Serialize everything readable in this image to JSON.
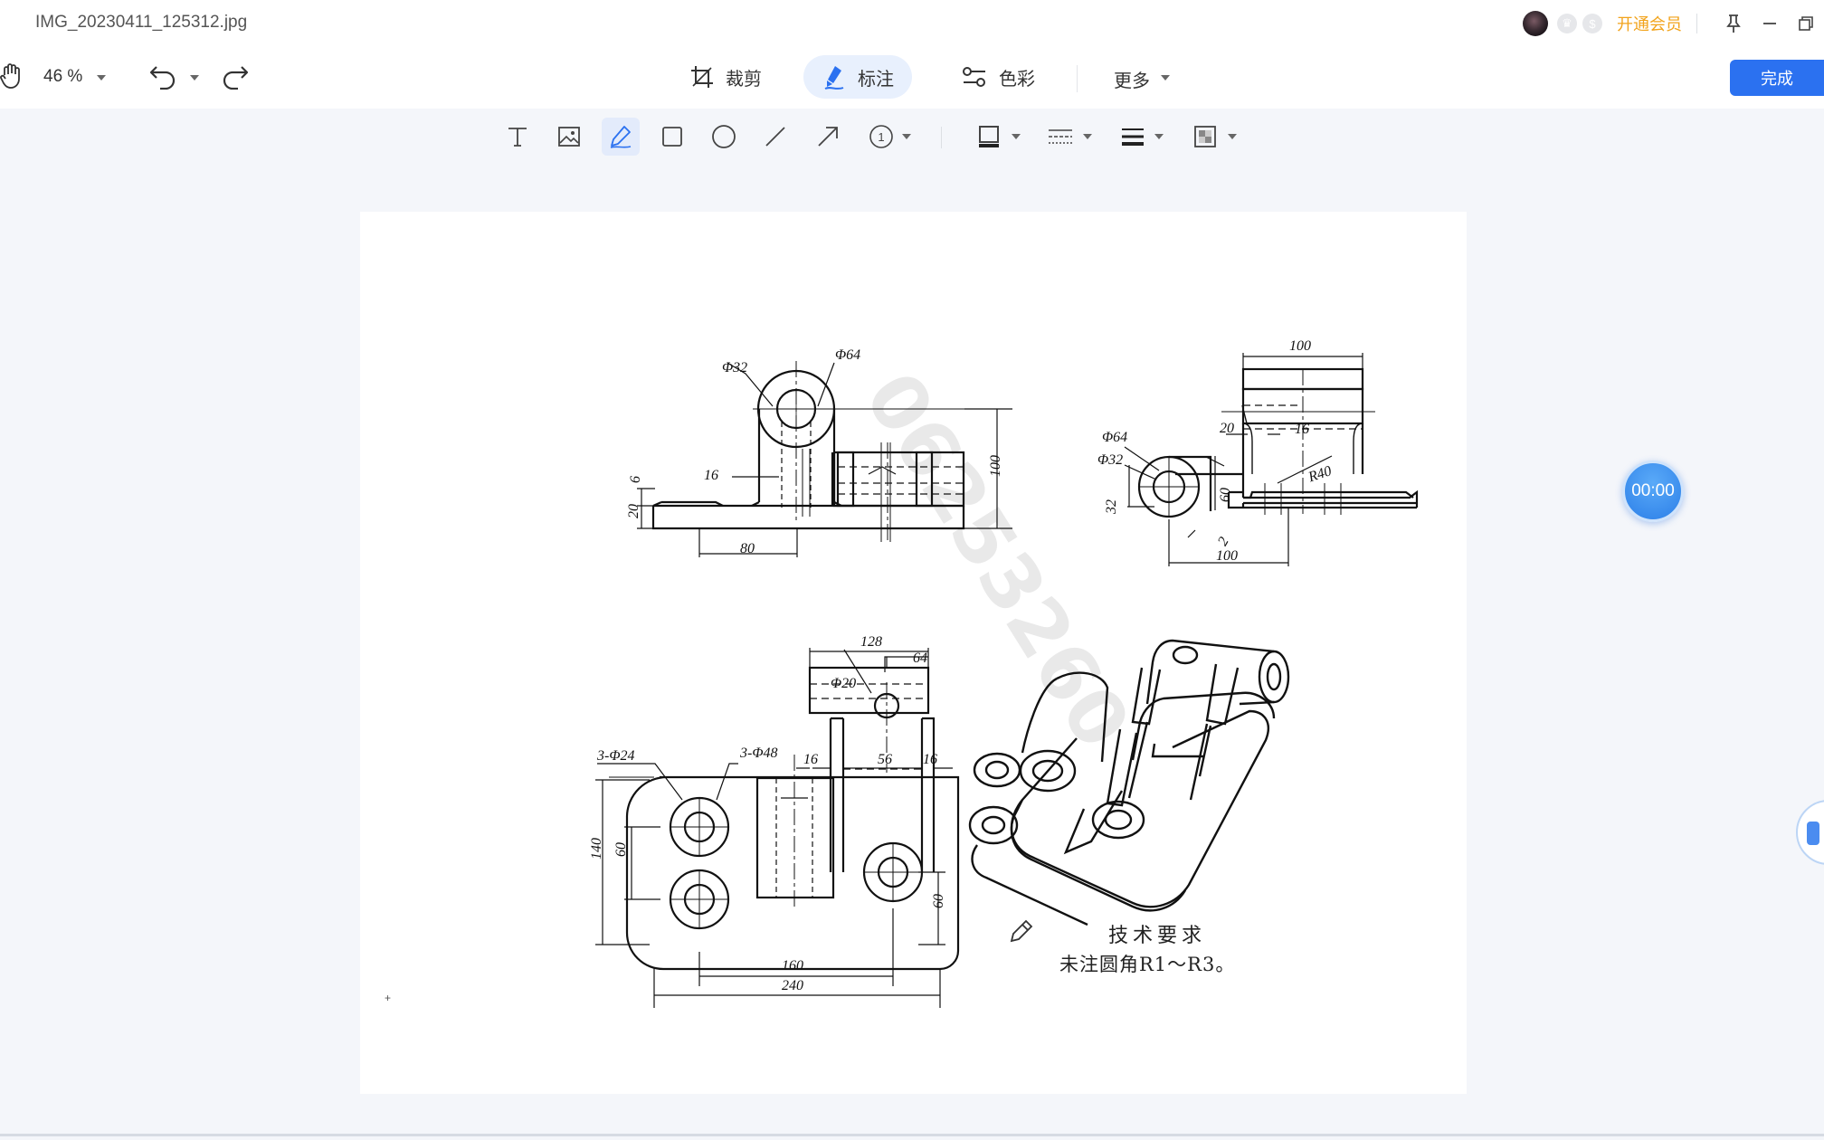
{
  "window": {
    "title": "IMG_20230411_125312.jpg",
    "vip_label": "开通会员"
  },
  "toolbar": {
    "zoom": "46 %",
    "tabs": [
      {
        "label": "裁剪",
        "icon": "crop-icon"
      },
      {
        "label": "标注",
        "icon": "annotate-icon"
      },
      {
        "label": "色彩",
        "icon": "color-adjust-icon"
      }
    ],
    "more_label": "更多",
    "done_label": "完成"
  },
  "annotation_tools": [
    "text-icon",
    "image-icon",
    "pen-icon",
    "rectangle-icon",
    "circle-icon",
    "line-icon",
    "arrow-icon",
    "number-marker-icon",
    "border-color-icon",
    "dash-style-icon",
    "line-weight-icon",
    "mosaic-icon"
  ],
  "timer": "00:00",
  "colors": {
    "accent": "#2b71f0",
    "vip": "#f2a31b",
    "active_tab": "#e8f0fd"
  },
  "drawing": {
    "watermark": "06253260",
    "dims": {
      "d1": "Φ32",
      "d2": "Φ64",
      "d3": "6",
      "d4": "16",
      "d5": "20",
      "d6": "80",
      "d7": "100",
      "d8": "100",
      "d9": "20",
      "d10": "16",
      "d11": "Φ64",
      "d12": "Φ32",
      "d13": "R40",
      "d14": "32",
      "d15": "60",
      "d16": "2",
      "d17": "100",
      "d18": "128",
      "d19": "64",
      "d20": "Φ20",
      "d21": "3-Φ24",
      "d22": "3-Φ48",
      "d23": "16",
      "d24": "56",
      "d25": "16",
      "d26": "140",
      "d27": "60",
      "d28": "60",
      "d29": "160",
      "d30": "240"
    },
    "tech_title": "技术要求",
    "tech_body": "未注圆角R1～R3。"
  }
}
